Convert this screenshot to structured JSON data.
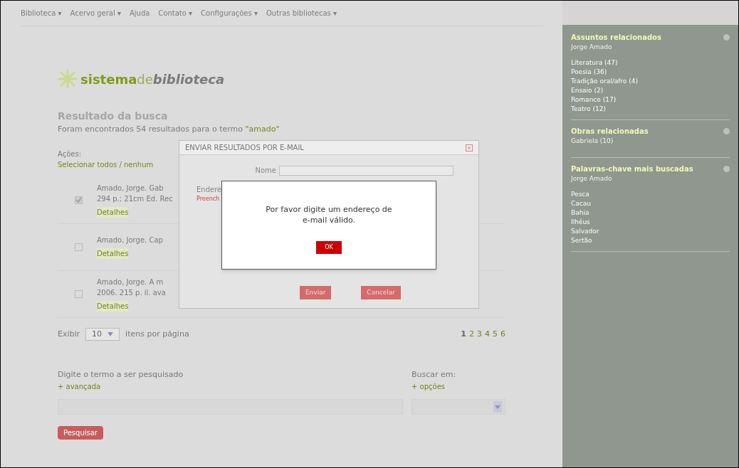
{
  "nav": [
    "Biblioteca ▾",
    "Acervo geral ▾",
    "Ajuda",
    "Contato ▾",
    "Configurações ▾",
    "Outras bibliotecas ▾"
  ],
  "logo": {
    "first": "sistema",
    "middle": "de",
    "last": "biblioteca"
  },
  "results": {
    "title": "Resultado da busca",
    "summary": "Foram encontrados 54 resultados para o termo",
    "term": "\"amado\"",
    "actions_label": "Ações:",
    "select_link": "Selecionar todos / nenhum",
    "items": [
      {
        "lines": [
          "Amado, Jorge. Gab",
          "294 p.; 21cm Ed. Rec"
        ],
        "link": "Detalhes",
        "checked": true
      },
      {
        "lines": [
          "Amado, Jorge. Cap"
        ],
        "link": "Detalhes",
        "checked": false
      },
      {
        "lines": [
          "Amado, Jorge. A m",
          "2006. 215 p. il. ava"
        ],
        "link": "Detalhes",
        "checked": false
      }
    ],
    "per_page": {
      "before": "Exibir",
      "value": "10",
      "after": "itens por página"
    },
    "pages": [
      {
        "label": "1",
        "selected": true
      },
      {
        "label": "2",
        "selected": false
      },
      {
        "label": "3",
        "selected": false
      },
      {
        "label": "4",
        "selected": false
      },
      {
        "label": "5",
        "selected": false
      },
      {
        "label": "6",
        "selected": false
      }
    ]
  },
  "search": {
    "label": "Digite o termo a ser pesquisado",
    "link": "+ avançada",
    "type_label": "Buscar em:",
    "type_link": "+ opções",
    "button": "Pesquisar"
  },
  "sidebar": [
    {
      "title": "Assuntos relacionados",
      "subtitle": "Jorge Amado",
      "items": [
        "Literatura (47)",
        "Poesia (36)",
        "Tradição oral/afro (4)",
        "Ensaio (2)",
        "Romance (17)",
        "Teatro (12)"
      ]
    },
    {
      "title": "Obras relacionadas",
      "subtitle": "Gabriela (10)"
    },
    {
      "title": "Palavras-chave mais buscadas",
      "subtitle": "Jorge Amado",
      "items": [
        "Pesca",
        "Cacau",
        "Bahia",
        "Ilhéus",
        "Salvador",
        "Sertão"
      ]
    }
  ],
  "dialog": {
    "title": "ENVIAR RESULTADOS POR E-MAIL",
    "name_label": "Nome",
    "email_label": "Endere",
    "email_hint": "Preench",
    "buttons": [
      "Enviar",
      "Cancelar"
    ]
  },
  "alert": {
    "message": "Por favor digite um endereço de e-mail válido.",
    "button": "OK"
  }
}
